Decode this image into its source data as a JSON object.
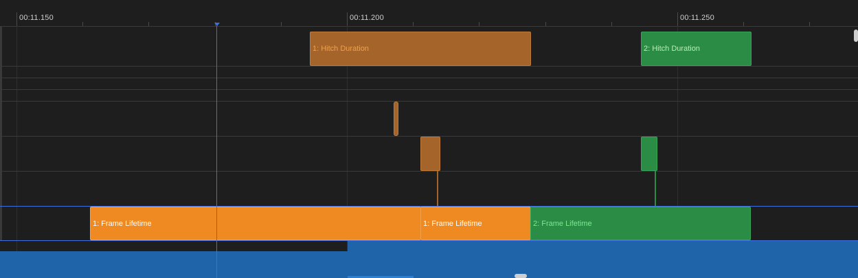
{
  "ruler": {
    "labels": [
      "00:11.150",
      "00:11.200",
      "00:11.250"
    ]
  },
  "events": {
    "hitch1": "1: Hitch Duration",
    "hitch2": "2: Hitch Duration",
    "frame1a": "1: Frame Lifetime",
    "frame1b": "1: Frame Lifetime",
    "frame2": "2: Frame Lifetime"
  },
  "colors": {
    "orange": "#ef8a22",
    "orange_dark": "#a5652a",
    "green": "#2a8c45",
    "blue": "#1f63a8",
    "cursor": "#3d6fe0"
  }
}
